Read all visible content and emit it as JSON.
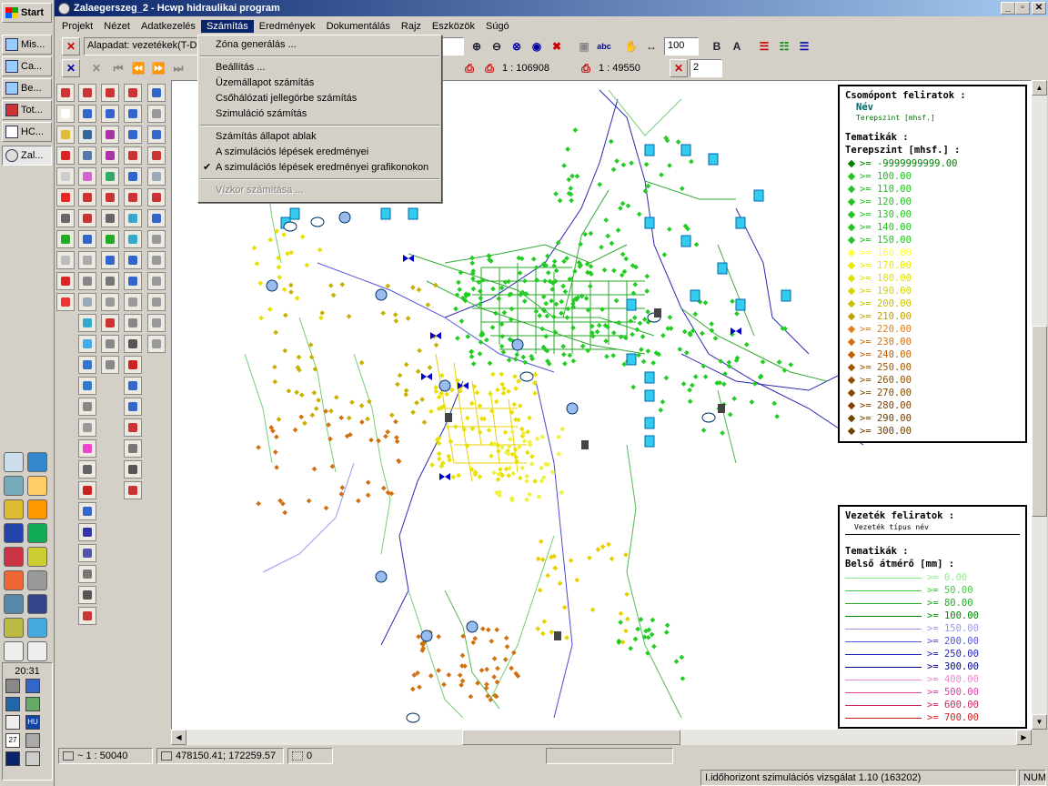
{
  "taskbar": {
    "start_label": "Start",
    "tasks": [
      "Mis...",
      "Ca...",
      "Be...",
      "Tot...",
      "HC...",
      "Zal..."
    ],
    "clock": "20:31",
    "language": "HU",
    "tray_date": "27"
  },
  "window": {
    "title": "Zalaegerszeg_2 - Hcwp hidraulikai program",
    "minimize": "_",
    "maximize": "▫",
    "close": "✕"
  },
  "menu": [
    "Projekt",
    "Nézet",
    "Adatkezelés",
    "Számítás",
    "Eredmények",
    "Dokumentálás",
    "Rajz",
    "Eszközök",
    "Súgó"
  ],
  "toolbar": {
    "layer_combo": "Alapadat: vezetékek(T-D...",
    "zoom_percent": "100",
    "bold_label": "B",
    "text_label": "A",
    "abc_label": "abc",
    "scale_1": "1 : 106908",
    "scale_2": "1 : 49550",
    "page_value": "2"
  },
  "dropdown": {
    "items": [
      {
        "label": "Zóna generálás ...",
        "enabled": true,
        "checked": false
      },
      {
        "separator": true
      },
      {
        "label": "Beállítás ...",
        "enabled": true,
        "checked": false
      },
      {
        "label": "Üzemállapot számítás",
        "enabled": true,
        "checked": false
      },
      {
        "label": "Csőhálózati jellegörbe számítás",
        "enabled": true,
        "checked": false
      },
      {
        "label": "Szimuláció számítás",
        "enabled": true,
        "checked": false
      },
      {
        "separator": true
      },
      {
        "label": "Számítás állapot ablak",
        "enabled": true,
        "checked": false
      },
      {
        "label": "A szimulációs lépések eredményei",
        "enabled": true,
        "checked": false
      },
      {
        "label": "A szimulációs lépések eredményei grafikonokon",
        "enabled": true,
        "checked": true
      },
      {
        "separator": true
      },
      {
        "label": "Vízkor számítása ...",
        "enabled": false,
        "checked": false
      }
    ]
  },
  "legend_nodes": {
    "title": "Csomópont feliratok :",
    "name_label": "Név",
    "sub_label": "Terepszint [mhsf.]",
    "thematic_title": "Tematikák :",
    "thematic_name": "Terepszint [mhsf.] :",
    "rows": [
      {
        "label": ">= -9999999999.00",
        "color": "#008000"
      },
      {
        "label": ">= 100.00",
        "color": "#22c422"
      },
      {
        "label": ">= 110.00",
        "color": "#22c422"
      },
      {
        "label": ">= 120.00",
        "color": "#22c422"
      },
      {
        "label": ">= 130.00",
        "color": "#22c422"
      },
      {
        "label": ">= 140.00",
        "color": "#22c422"
      },
      {
        "label": ">= 150.00",
        "color": "#22c422"
      },
      {
        "label": ">= 160.00",
        "color": "#ffff40"
      },
      {
        "label": ">= 170.00",
        "color": "#e8e800"
      },
      {
        "label": ">= 180.00",
        "color": "#e0e000"
      },
      {
        "label": ">= 190.00",
        "color": "#d4d400"
      },
      {
        "label": ">= 200.00",
        "color": "#c8c000"
      },
      {
        "label": ">= 210.00",
        "color": "#c0a000"
      },
      {
        "label": ">= 220.00",
        "color": "#e08020"
      },
      {
        "label": ">= 230.00",
        "color": "#d07010"
      },
      {
        "label": ">= 240.00",
        "color": "#c06000"
      },
      {
        "label": ">= 250.00",
        "color": "#a05800"
      },
      {
        "label": ">= 260.00",
        "color": "#905000"
      },
      {
        "label": ">= 270.00",
        "color": "#804800"
      },
      {
        "label": ">= 280.00",
        "color": "#804000"
      },
      {
        "label": ">= 290.00",
        "color": "#704000"
      },
      {
        "label": ">= 300.00",
        "color": "#704000"
      }
    ]
  },
  "legend_pipes": {
    "title": "Vezeték feliratok :",
    "sub_label": "Vezeték típus név",
    "thematic_title": "Tematikák :",
    "thematic_name": "Belső átmérő [mm] :",
    "rows": [
      {
        "label": ">= 0.00",
        "color": "#88ee88"
      },
      {
        "label": ">= 50.00",
        "color": "#44cc44"
      },
      {
        "label": ">= 80.00",
        "color": "#22aa22"
      },
      {
        "label": ">= 100.00",
        "color": "#008800"
      },
      {
        "label": ">= 150.00",
        "color": "#9999ee"
      },
      {
        "label": ">= 200.00",
        "color": "#5555dd"
      },
      {
        "label": ">= 250.00",
        "color": "#2222bb"
      },
      {
        "label": ">= 300.00",
        "color": "#000088"
      },
      {
        "label": ">= 400.00",
        "color": "#ee88cc"
      },
      {
        "label": ">= 500.00",
        "color": "#dd44aa"
      },
      {
        "label": ">= 600.00",
        "color": "#cc2266"
      },
      {
        "label": ">= 700.00",
        "color": "#cc2222"
      }
    ]
  },
  "status": {
    "scale": "~ 1 : 50040",
    "coords": "478150.41; 172259.57",
    "count": "0",
    "message": "I.időhorizont szimulációs vizsgálat 1.10 (163202)",
    "num": "NUM"
  }
}
